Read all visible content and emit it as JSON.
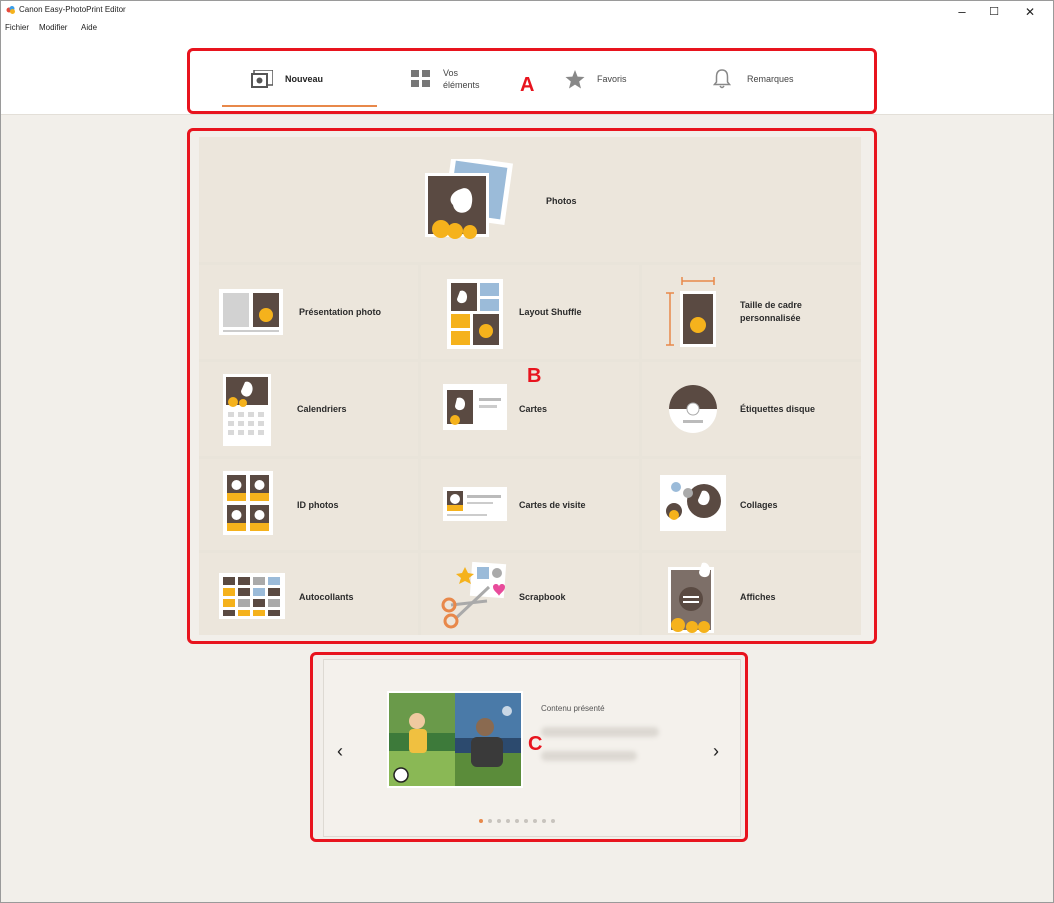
{
  "window": {
    "title": "Canon Easy-PhotoPrint Editor",
    "minimize": "–",
    "maximize": "☐",
    "close": "✕"
  },
  "menu": [
    "Fichier",
    "Modifier",
    "Aide"
  ],
  "tabs": [
    {
      "label": "Nouveau",
      "icon": "new-project-icon",
      "active": true
    },
    {
      "label": "Vos\néléments",
      "icon": "grid-icon",
      "active": false
    },
    {
      "label": "Favoris",
      "icon": "star-icon",
      "active": false
    },
    {
      "label": "Remarques",
      "icon": "bell-icon",
      "active": false
    }
  ],
  "callouts": {
    "a": "A",
    "b": "B",
    "c": "C"
  },
  "tiles": {
    "photos": "Photos",
    "presentation": "Présentation photo",
    "layout_shuffle": "Layout Shuffle",
    "taille_cadre": "Taille de cadre\npersonnalisée",
    "calendriers": "Calendriers",
    "cartes": "Cartes",
    "etiquettes": "Étiquettes disque",
    "id_photos": "ID photos",
    "cartes_visite": "Cartes de visite",
    "collages": "Collages",
    "autocollants": "Autocollants",
    "scrapbook": "Scrapbook",
    "affiches": "Affiches"
  },
  "featured": {
    "title": "Contenu présenté",
    "prev": "‹",
    "next": "›",
    "dot_count": 9,
    "active_dot": 1
  },
  "colors": {
    "accent": "#e8884a",
    "highlight": "#e8141e",
    "yellow": "#f5b21c",
    "dark": "#5a4a42"
  }
}
